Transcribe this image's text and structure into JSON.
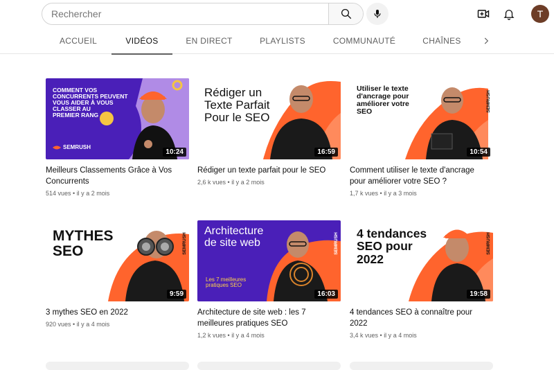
{
  "search": {
    "placeholder": "Rechercher"
  },
  "header": {
    "icons": [
      "search-icon",
      "mic-icon",
      "create-video-icon",
      "bell-icon"
    ],
    "avatar_initial": "T",
    "avatar_color": "#6d3d27"
  },
  "tabs": [
    {
      "label": "ACCUEIL",
      "active": false
    },
    {
      "label": "VIDÉOS",
      "active": true
    },
    {
      "label": "EN DIRECT",
      "active": false
    },
    {
      "label": "PLAYLISTS",
      "active": false
    },
    {
      "label": "COMMUNAUTÉ",
      "active": false
    },
    {
      "label": "CHAÎNES",
      "active": false
    }
  ],
  "brand": {
    "orange": "#ff642d",
    "purple": "#4a1fb8",
    "name": "SEMRUSH"
  },
  "videos": [
    {
      "title": "Meilleurs Classements Grâce à Vos Concurrents",
      "views": "514 vues",
      "age": "il y a 2 mois",
      "duration": "10:24",
      "thumb_text": [
        "COMMENT VOS",
        "CONCURRENTS PEUVENT",
        "VOUS AIDER À VOUS",
        "CLASSER AU",
        "PREMIER RANG"
      ]
    },
    {
      "title": "Rédiger un texte parfait pour le SEO",
      "views": "2,6 k vues",
      "age": "il y a 2 mois",
      "duration": "16:59",
      "thumb_text": [
        "Rédiger un",
        "Texte Parfait",
        "Pour le SEO"
      ]
    },
    {
      "title": "Comment utiliser le texte d'ancrage pour améliorer votre SEO ?",
      "views": "1,7 k vues",
      "age": "il y a 3 mois",
      "duration": "10:54",
      "thumb_text": [
        "Utiliser le texte",
        "d'ancrage pour",
        "améliorer votre",
        "SEO"
      ]
    },
    {
      "title": "3 mythes SEO en 2022",
      "views": "920 vues",
      "age": "il y a 4 mois",
      "duration": "9:59",
      "thumb_text": [
        "MYTHES",
        "SEO"
      ]
    },
    {
      "title": "Architecture de site web : les 7 meilleures pratiques SEO",
      "views": "1,2 k vues",
      "age": "il y a 4 mois",
      "duration": "16:03",
      "thumb_text": [
        "Architecture",
        "de site web",
        "Les 7 meilleures",
        "pratiques SEO"
      ]
    },
    {
      "title": "4 tendances SEO à connaître pour 2022",
      "views": "3,4 k vues",
      "age": "il y a 4 mois",
      "duration": "19:58",
      "thumb_text": [
        "4 tendances",
        "SEO pour",
        "2022"
      ]
    }
  ]
}
